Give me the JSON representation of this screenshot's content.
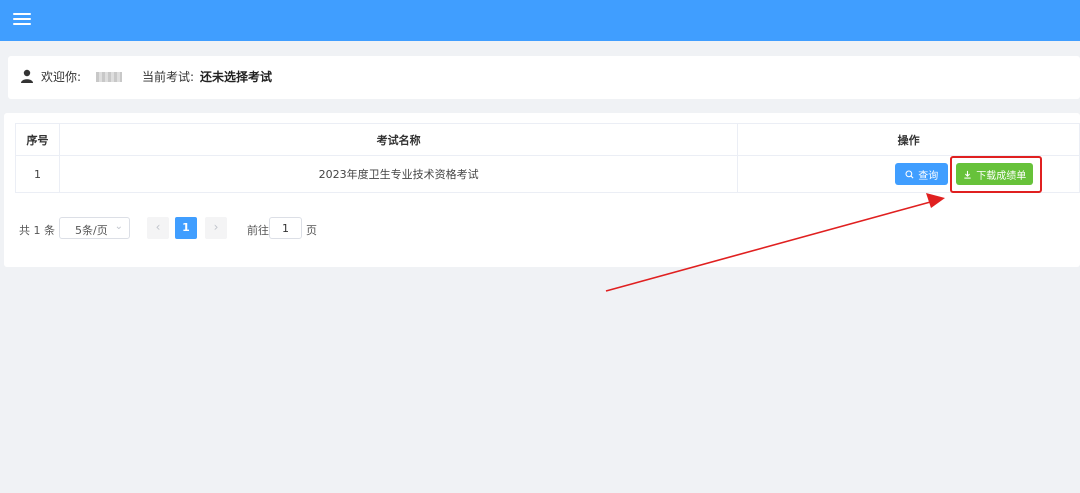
{
  "header": {
    "menu_icon": "hamburger-menu-icon",
    "bg_color": "#409eff"
  },
  "welcome": {
    "user_icon": "user-icon",
    "greeting_label": "欢迎你:",
    "current_exam_label": "当前考试:",
    "current_exam_value": "还未选择考试"
  },
  "table": {
    "headers": [
      "序号",
      "考试名称",
      "操作"
    ],
    "rows": [
      {
        "index": "1",
        "exam_name": "2023年度卫生专业技术资格考试",
        "query_label": "查询",
        "download_label": "下载成绩单"
      }
    ]
  },
  "pagination": {
    "total_text": "共 1 条",
    "page_size": "5条/页",
    "current_page": "1",
    "goto_prefix": "前往",
    "goto_value": "1",
    "goto_suffix": "页"
  },
  "colors": {
    "primary": "#409eff",
    "success": "#67c23a",
    "annotation": "#e02020"
  }
}
